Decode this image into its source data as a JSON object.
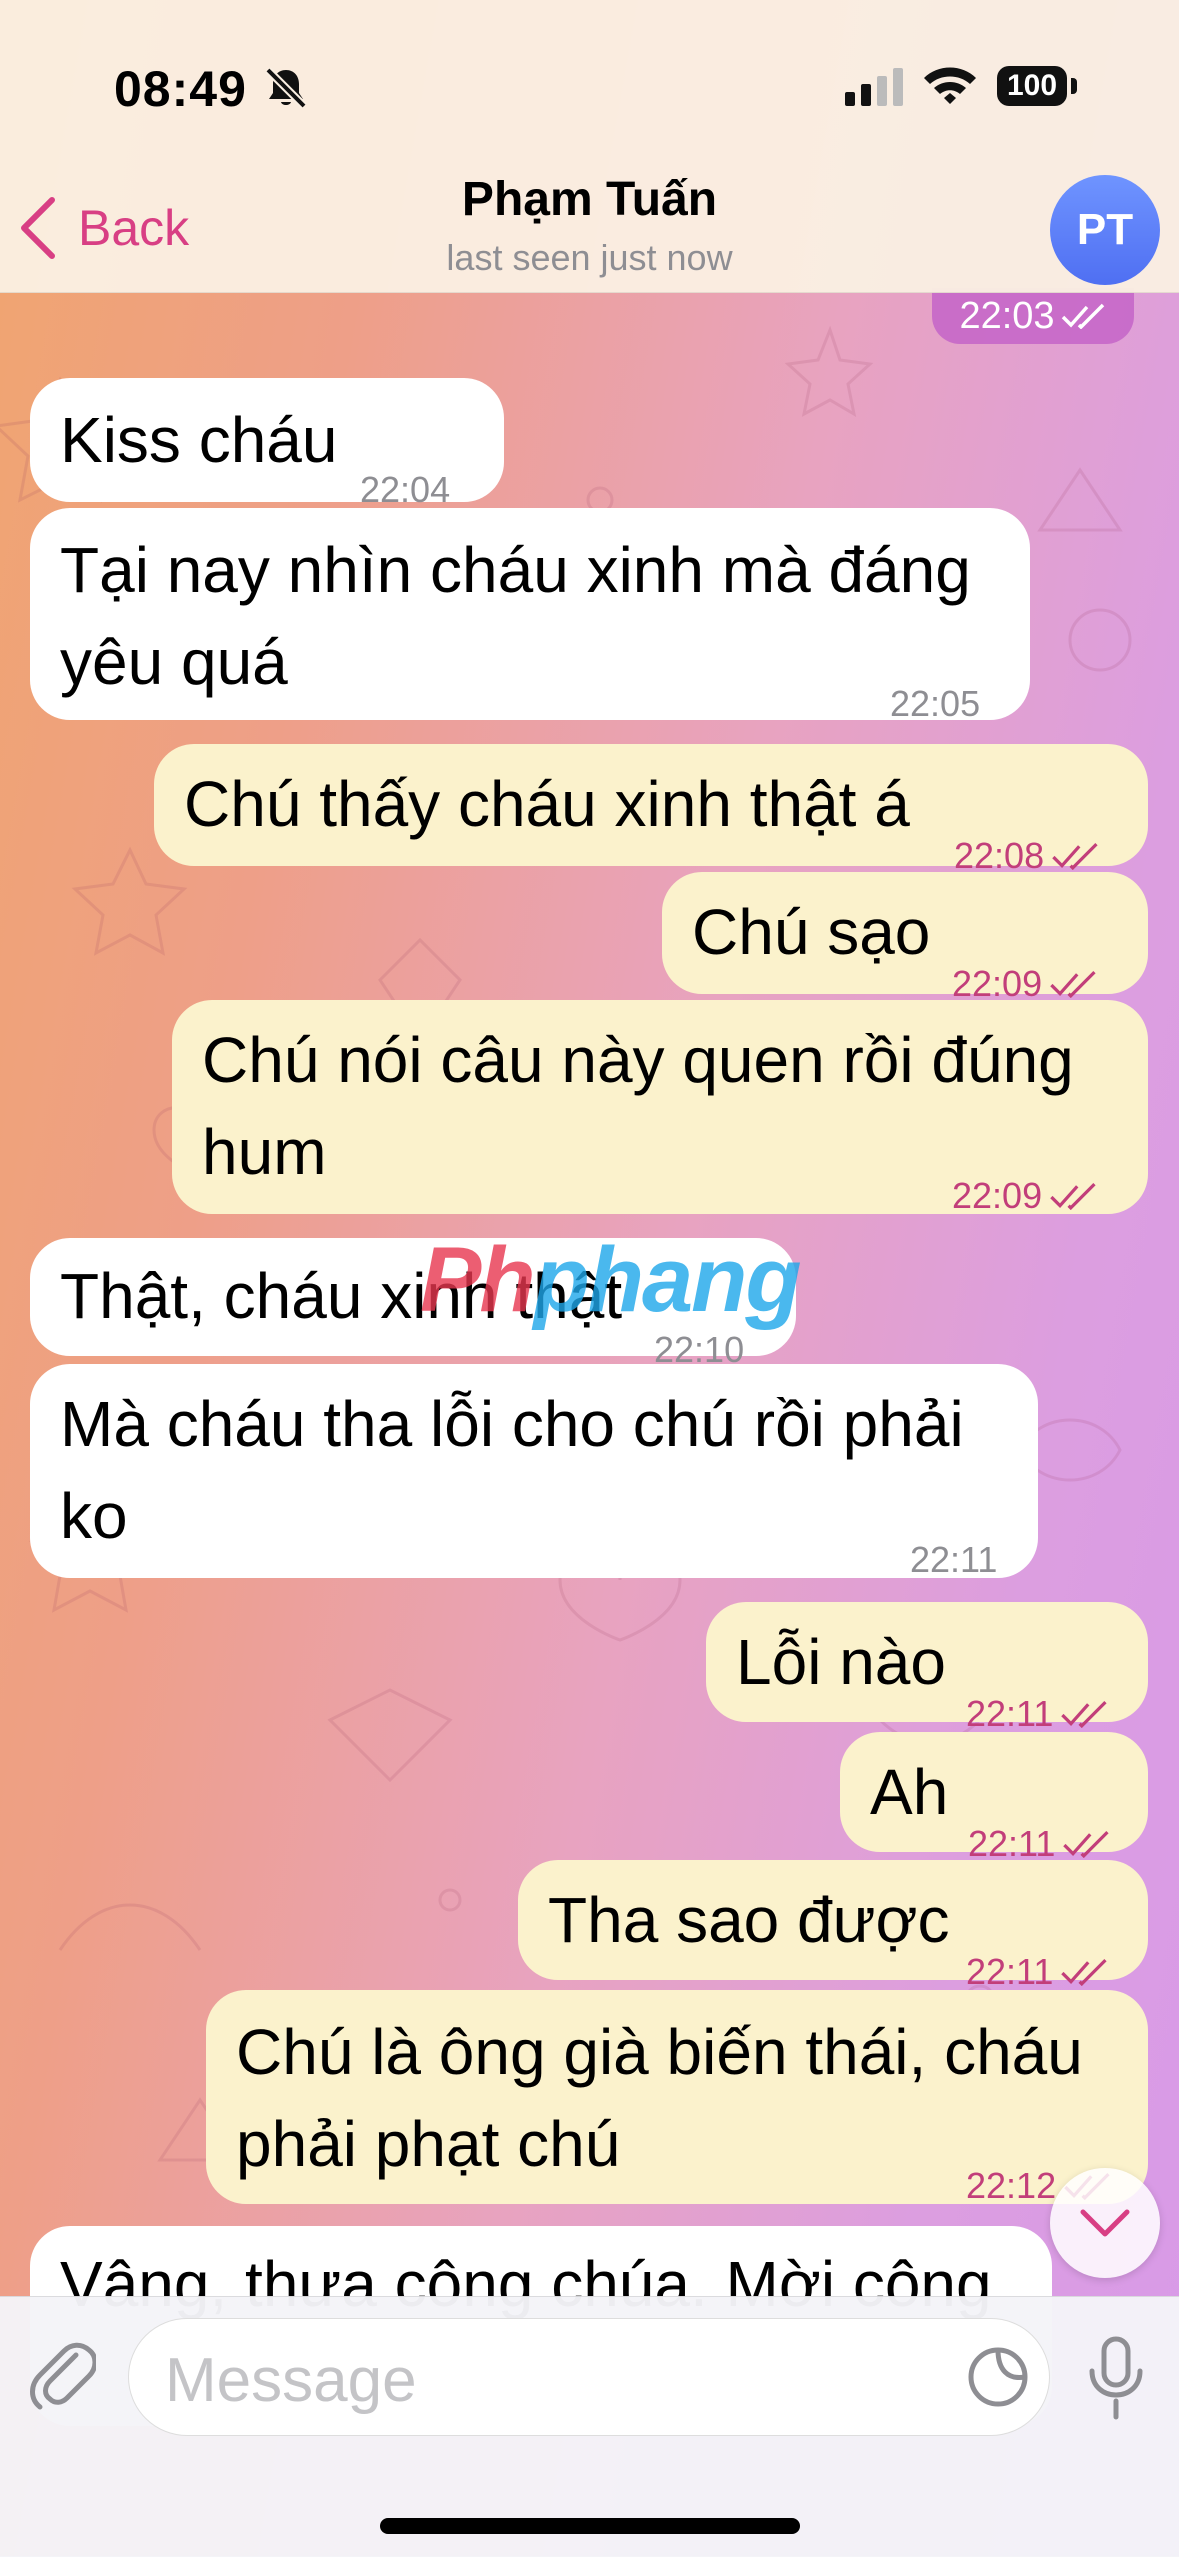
{
  "status": {
    "time": "08:49",
    "battery": "100"
  },
  "header": {
    "back_label": "Back",
    "name": "Phạm Tuấn",
    "subtitle": "last seen just now",
    "avatar_initials": "PT"
  },
  "top_partial_time": "22:03",
  "messages": [
    {
      "dir": "in",
      "text": "Kiss cháu",
      "time": "22:04"
    },
    {
      "dir": "in",
      "text": "Tại nay nhìn cháu xinh mà đáng yêu quá",
      "time": "22:05"
    },
    {
      "dir": "out",
      "text": "Chú thấy cháu xinh thật á",
      "time": "22:08"
    },
    {
      "dir": "out",
      "text": "Chú sạo",
      "time": "22:09"
    },
    {
      "dir": "out",
      "text": "Chú nói câu này quen rồi đúng hum",
      "time": "22:09"
    },
    {
      "dir": "in",
      "text": "Thật, cháu xinh thật",
      "time": "22:10"
    },
    {
      "dir": "in",
      "text": "Mà cháu tha lỗi cho chú rồi phải ko",
      "time": "22:11"
    },
    {
      "dir": "out",
      "text": "Lỗi nào",
      "time": "22:11"
    },
    {
      "dir": "out",
      "text": "Ah",
      "time": "22:11"
    },
    {
      "dir": "out",
      "text": "Tha sao được",
      "time": "22:11"
    },
    {
      "dir": "out",
      "text": "Chú là ông già biến thái, cháu phải phạt chú",
      "time": "22:12"
    },
    {
      "dir": "in",
      "text": "Vâng, thưa công chúa. Mời công",
      "time": ""
    }
  ],
  "watermark": {
    "part1": "Ph",
    "part2": "phang"
  },
  "input": {
    "placeholder": "Message"
  },
  "colors": {
    "accent": "#d83f84",
    "outgoing_bubble": "#fbf2cc",
    "incoming_bubble": "#ffffff",
    "avatar": "#5b7cf5"
  },
  "icons": [
    "bell-slash-icon",
    "signal-icon",
    "wifi-icon",
    "chevron-left-icon",
    "double-check-icon",
    "chevron-down-icon",
    "paperclip-icon",
    "sticker-icon",
    "microphone-icon"
  ]
}
